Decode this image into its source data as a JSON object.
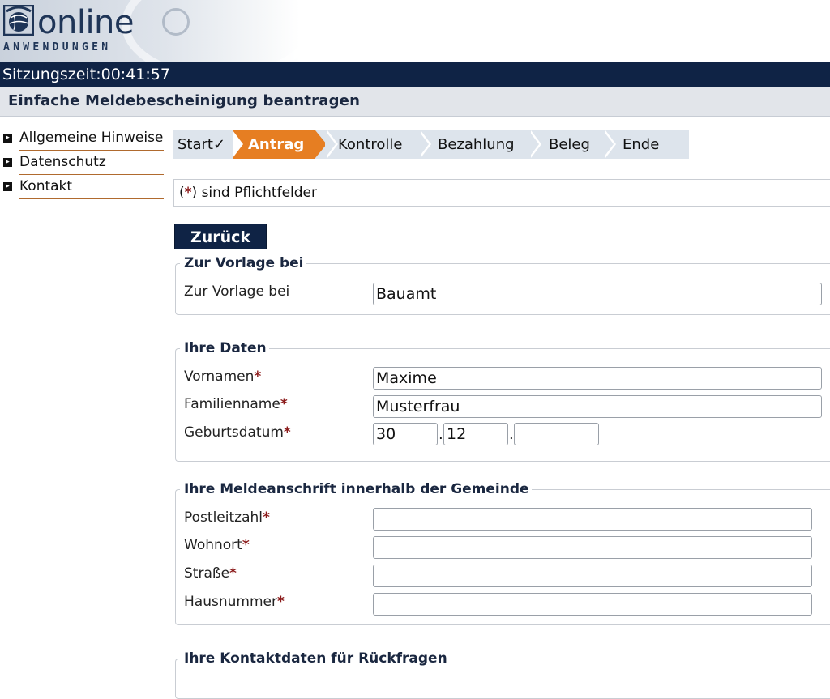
{
  "header": {
    "logo_text": "online",
    "logo_sub": "ANWENDUNGEN"
  },
  "session": {
    "label": "Sitzungszeit:",
    "time": "00:41:57"
  },
  "page_title": "Einfache Meldebescheinigung beantragen",
  "sidebar": {
    "items": [
      {
        "label": "Allgemeine Hinweise"
      },
      {
        "label": "Datenschutz"
      },
      {
        "label": "Kontakt"
      }
    ]
  },
  "steps": [
    {
      "label": "Start",
      "state": "done",
      "mark": "✓"
    },
    {
      "label": "Antrag",
      "state": "active"
    },
    {
      "label": "Kontrolle",
      "state": "pending"
    },
    {
      "label": "Bezahlung",
      "state": "pending"
    },
    {
      "label": "Beleg",
      "state": "pending"
    },
    {
      "label": "Ende",
      "state": "pending"
    }
  ],
  "notice": {
    "open": "(",
    "star": "*",
    "text": ") sind Pflichtfelder"
  },
  "back_button": "Zurück",
  "required_mark": "*",
  "sections": {
    "vorlage": {
      "legend": "Zur Vorlage bei",
      "field_label": "Zur Vorlage bei",
      "value": "Bauamt"
    },
    "daten": {
      "legend": "Ihre Daten",
      "vornamen_label": "Vornamen",
      "vornamen_value": "Maxime",
      "familienname_label": "Familienname",
      "familienname_value": "Musterfrau",
      "geburtsdatum_label": "Geburtsdatum",
      "geburtsdatum_day": "30",
      "geburtsdatum_month": "12",
      "geburtsdatum_year": "",
      "date_sep": "."
    },
    "anschrift": {
      "legend": "Ihre Meldeanschrift innerhalb der Gemeinde",
      "plz_label": "Postleitzahl",
      "plz_value": "",
      "wohnort_label": "Wohnort",
      "wohnort_value": "",
      "strasse_label": "Straße",
      "strasse_value": "",
      "hausnummer_label": "Hausnummer",
      "hausnummer_value": ""
    },
    "kontakt": {
      "legend": "Ihre Kontaktdaten für Rückfragen"
    }
  },
  "colors": {
    "navy": "#0f2345",
    "accent_orange": "#e67e22",
    "required_red": "#8b1a1a"
  }
}
